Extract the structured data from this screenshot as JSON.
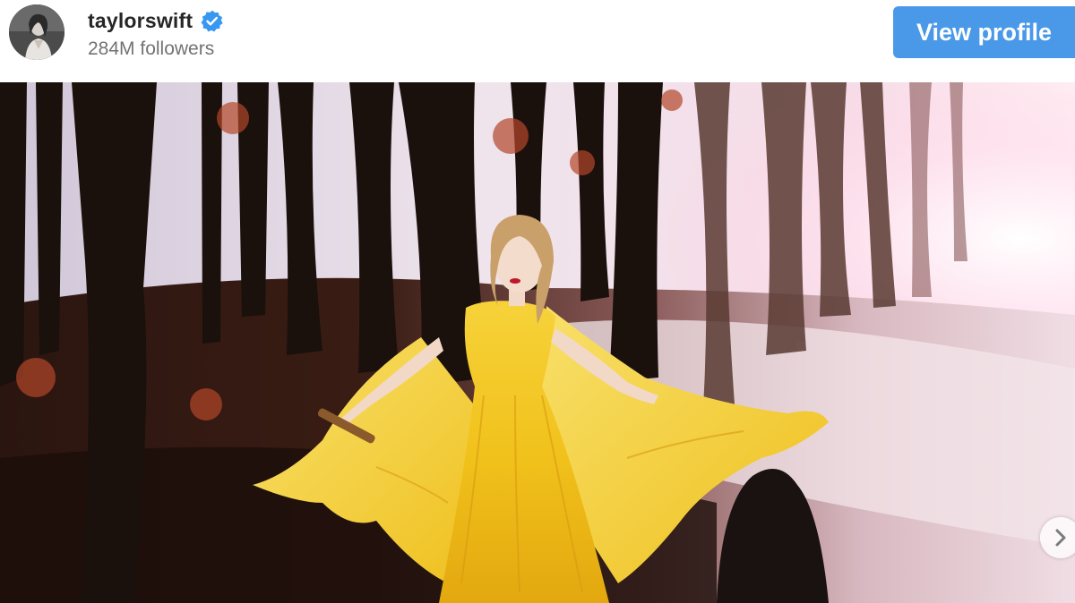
{
  "profile": {
    "username": "taylorswift",
    "verified": true,
    "followers_text": "284M followers",
    "avatar_icon": "profile-avatar"
  },
  "actions": {
    "view_profile_label": "View profile"
  },
  "post": {
    "media_icon": "post-photo",
    "next_icon": "chevron-right-icon"
  },
  "colors": {
    "button_bg": "#4a99e9",
    "verified_badge": "#3897f0",
    "username": "#262626",
    "followers": "#737373"
  }
}
